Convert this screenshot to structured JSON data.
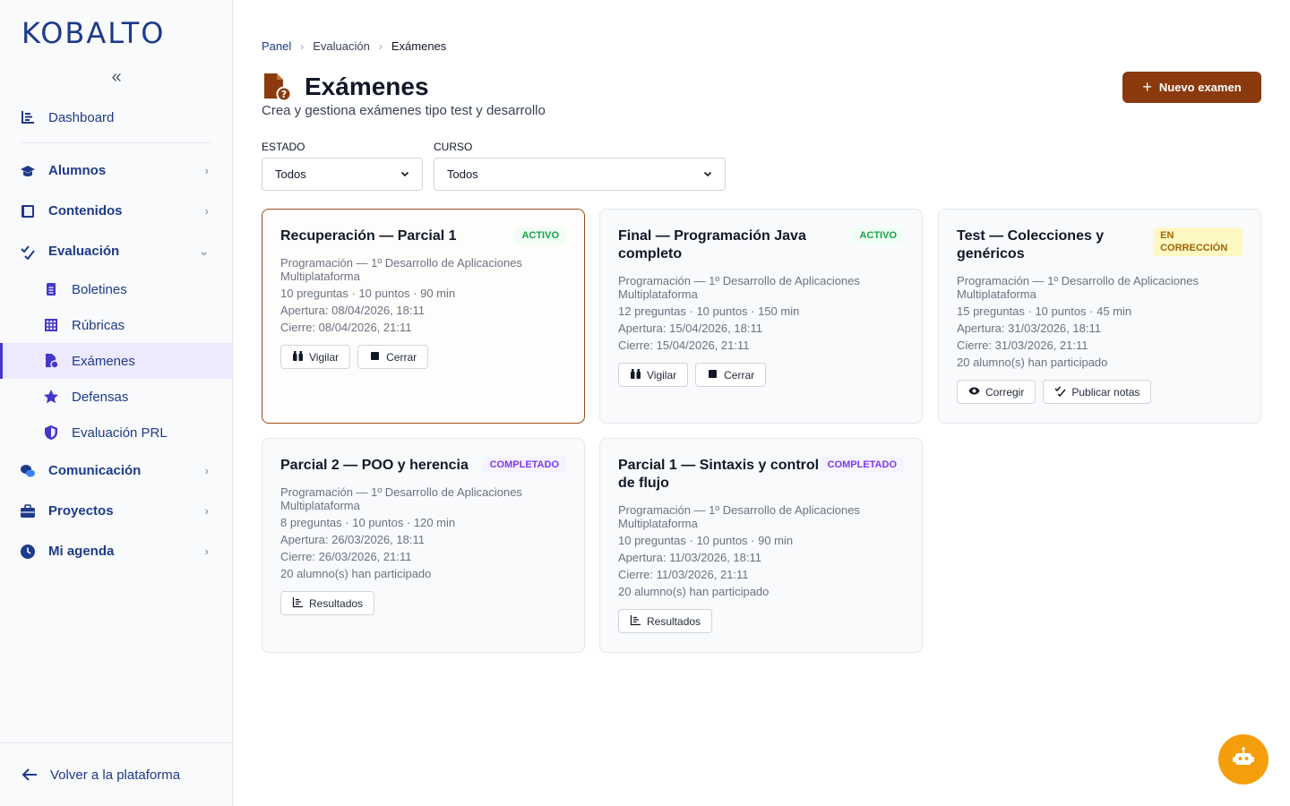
{
  "app": {
    "logo": "KOBALTO"
  },
  "sidebar": {
    "collapse_icon": "double-chevron-left-icon",
    "dashboard": "Dashboard",
    "groups": [
      {
        "label": "Alumnos",
        "icon": "graduation-cap-icon"
      },
      {
        "label": "Contenidos",
        "icon": "book-icon"
      },
      {
        "label": "Evaluación",
        "icon": "check-icon"
      },
      {
        "label": "Comunicación",
        "icon": "chat-icon"
      },
      {
        "label": "Proyectos",
        "icon": "briefcase-icon"
      },
      {
        "label": "Mi agenda",
        "icon": "clock-icon"
      }
    ],
    "sub_items": [
      {
        "label": "Boletines",
        "icon": "clipboard-icon"
      },
      {
        "label": "Rúbricas",
        "icon": "grid-icon"
      },
      {
        "label": "Exámenes",
        "icon": "file-question-icon"
      },
      {
        "label": "Defensas",
        "icon": "star-icon"
      },
      {
        "label": "Evaluación PRL",
        "icon": "shield-icon"
      }
    ],
    "footer": "Volver a la plataforma"
  },
  "breadcrumb": [
    "Panel",
    "Evaluación",
    "Exámenes"
  ],
  "page": {
    "title": "Exámenes",
    "subtitle": "Crea y gestiona exámenes tipo test y desarrollo",
    "new_button": "Nuevo examen"
  },
  "filters": {
    "estado_label": "ESTADO",
    "estado_value": "Todos",
    "curso_label": "CURSO",
    "curso_value": "Todos"
  },
  "exams": [
    {
      "title": "Recuperación — Parcial 1",
      "status": "ACTIVO",
      "course": "Programación — 1º Desarrollo de Aplicaciones Multiplataforma",
      "stats": "10 preguntas · 10 puntos · 90 min",
      "opening": "Apertura: 08/04/2026, 18:11",
      "closing": "Cierre: 08/04/2026, 21:11",
      "actions": [
        "Vigilar",
        "Cerrar"
      ]
    },
    {
      "title": "Final — Programación Java completo",
      "status": "ACTIVO",
      "course": "Programación — 1º Desarrollo de Aplicaciones Multiplataforma",
      "stats": "12 preguntas · 10 puntos · 150 min",
      "opening": "Apertura: 15/04/2026, 18:11",
      "closing": "Cierre: 15/04/2026, 21:11",
      "actions": [
        "Vigilar",
        "Cerrar"
      ]
    },
    {
      "title": "Test — Colecciones y genéricos",
      "status": "EN CORRECCIÓN",
      "course": "Programación — 1º Desarrollo de Aplicaciones Multiplataforma",
      "stats": "15 preguntas · 10 puntos · 45 min",
      "opening": "Apertura: 31/03/2026, 18:11",
      "closing": "Cierre: 31/03/2026, 21:11",
      "participants": "20 alumno(s) han participado",
      "actions": [
        "Corregir",
        "Publicar notas"
      ]
    },
    {
      "title": "Parcial 2 — POO y herencia",
      "status": "COMPLETADO",
      "course": "Programación — 1º Desarrollo de Aplicaciones Multiplataforma",
      "stats": "8 preguntas · 10 puntos · 120 min",
      "opening": "Apertura: 26/03/2026, 18:11",
      "closing": "Cierre: 26/03/2026, 21:11",
      "participants": "20 alumno(s) han participado",
      "actions": [
        "Resultados"
      ]
    },
    {
      "title": "Parcial 1 — Sintaxis y control de flujo",
      "status": "COMPLETADO",
      "course": "Programación — 1º Desarrollo de Aplicaciones Multiplataforma",
      "stats": "10 preguntas · 10 puntos · 90 min",
      "opening": "Apertura: 11/03/2026, 18:11",
      "closing": "Cierre: 11/03/2026, 21:11",
      "participants": "20 alumno(s) han participado",
      "actions": [
        "Resultados"
      ]
    }
  ],
  "assistant": {
    "icon": "robot-icon"
  },
  "colors": {
    "brand": "#1e3a8a",
    "accent": "#8b3a0e",
    "active": "#16a34a",
    "completed": "#7c3aed",
    "correction": "#a16207",
    "assistant": "#f59e0b"
  }
}
